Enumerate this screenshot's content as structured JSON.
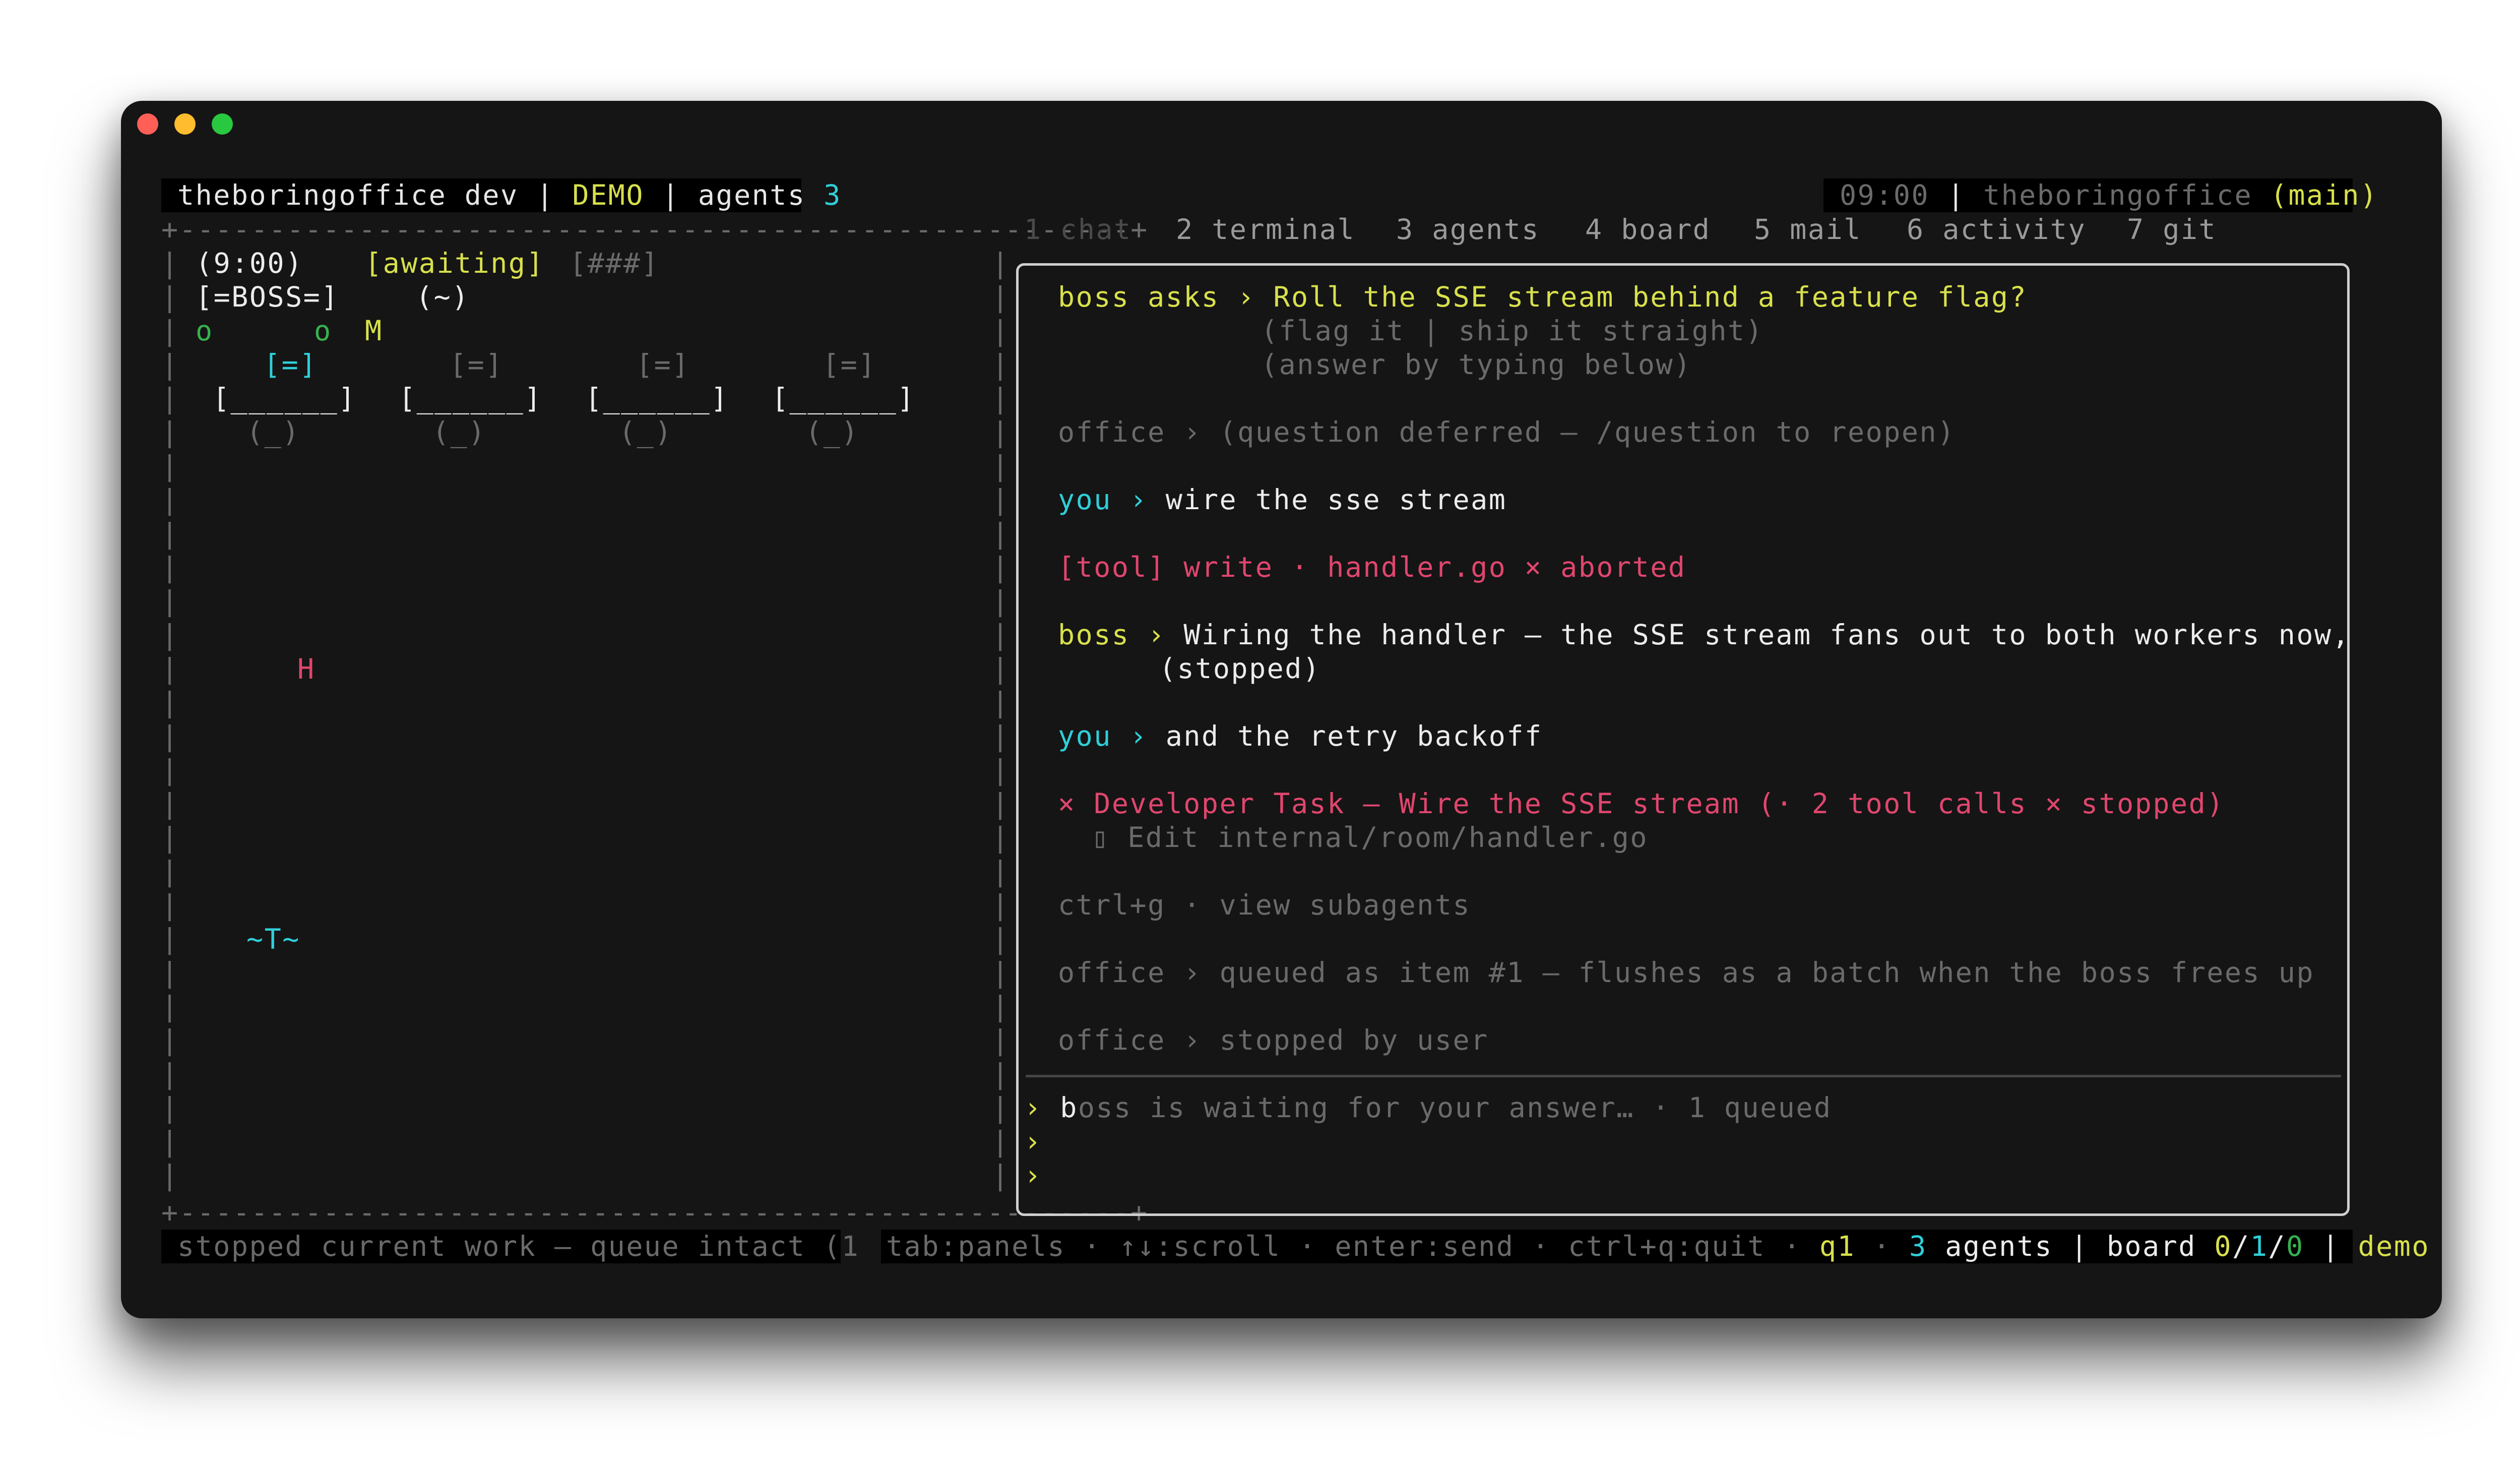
{
  "window": {
    "traffic_lights": [
      "#ff5f57",
      "#febc2e",
      "#28c840"
    ]
  },
  "header": {
    "app": "theboringoffice dev",
    "sep1": "|",
    "mode": "DEMO",
    "sep2": "|",
    "agents_label": "agents",
    "agents_count": "3",
    "clock": "09:00",
    "sep3": "|",
    "repo": "theboringoffice",
    "branch": "(main)"
  },
  "frame": {
    "top": "+-----------------------------------------------------+",
    "bottom": "+-----------------------------------------------------+",
    "left_col": "|\n|\n|\n|\n|\n|\n|\n|\n|\n|\n|\n|\n|\n|\n|\n|\n|\n|\n|\n|\n|\n|\n|\n|\n|\n|\n|\n|",
    "right_col": "|\n|\n|\n|\n|\n|\n|\n|\n|\n|\n|\n|\n|\n|\n|\n|\n|\n|\n|\n|\n|\n|\n|\n|\n|\n|\n|\n|"
  },
  "tabs": [
    {
      "label": "1 chat"
    },
    {
      "label": "2 terminal"
    },
    {
      "label": "3 agents"
    },
    {
      "label": "4 board"
    },
    {
      "label": "5 mail"
    },
    {
      "label": "6 activity"
    },
    {
      "label": "7 git"
    }
  ],
  "office": {
    "time": "(9:00)",
    "status": "[awaiting]",
    "progress": "[###]",
    "boss": "[=BOSS=]",
    "boss_face": "(~)",
    "sprites": [
      "o",
      "o",
      "M",
      "H",
      "~T~"
    ],
    "monitor": "[=]",
    "desk": "[______]",
    "chair": "(_)"
  },
  "chat": {
    "q_speaker": "boss asks",
    "q_arrow": "›",
    "q_text": "Roll the SSE stream behind a feature flag?",
    "q_options": "(flag it | ship it straight)",
    "q_hint": "(answer by typing below)",
    "m1_speaker": "office",
    "m1_arrow": "›",
    "m1_text": "(question deferred — /question to reopen)",
    "m2_speaker": "you",
    "m2_arrow": "›",
    "m2_text": "wire the sse stream",
    "m3_text": "[tool] write · handler.go × aborted",
    "m4_speaker": "boss",
    "m4_arrow": "›",
    "m4_text": "Wiring the handler — the SSE stream fans out to both workers now,",
    "m4_cont": "(stopped)",
    "m5_speaker": "you",
    "m5_arrow": "›",
    "m5_text": "and the retry backoff",
    "m6_text": "× Developer Task — Wire the SSE stream (· 2 tool calls × stopped)",
    "m6_sub_icon": "▯",
    "m6_sub": "Edit internal/room/handler.go",
    "m7_text": "ctrl+g · view subagents",
    "m8_speaker": "office",
    "m8_arrow": "›",
    "m8_text": "queued as item #1 — flushes as a batch when the boss frees up",
    "m9_speaker": "office",
    "m9_arrow": "›",
    "m9_text": "stopped by user",
    "prompt": "›",
    "input_cursor": "b",
    "input_placeholder": "oss is waiting for your answer… · 1 queued"
  },
  "footer": {
    "status": "stopped current work — queue intact (1",
    "hints": "tab:panels · ↑↓:scroll · enter:send · ctrl+q:quit ·",
    "queue": "q1",
    "dot": "·",
    "agents_count": "3",
    "agents_label": "agents",
    "sep1": "|",
    "board_label": "board",
    "board_a": "0",
    "slash1": "/",
    "board_b": "1",
    "slash2": "/",
    "board_c": "0",
    "sep2": "|",
    "mode": "demo"
  }
}
